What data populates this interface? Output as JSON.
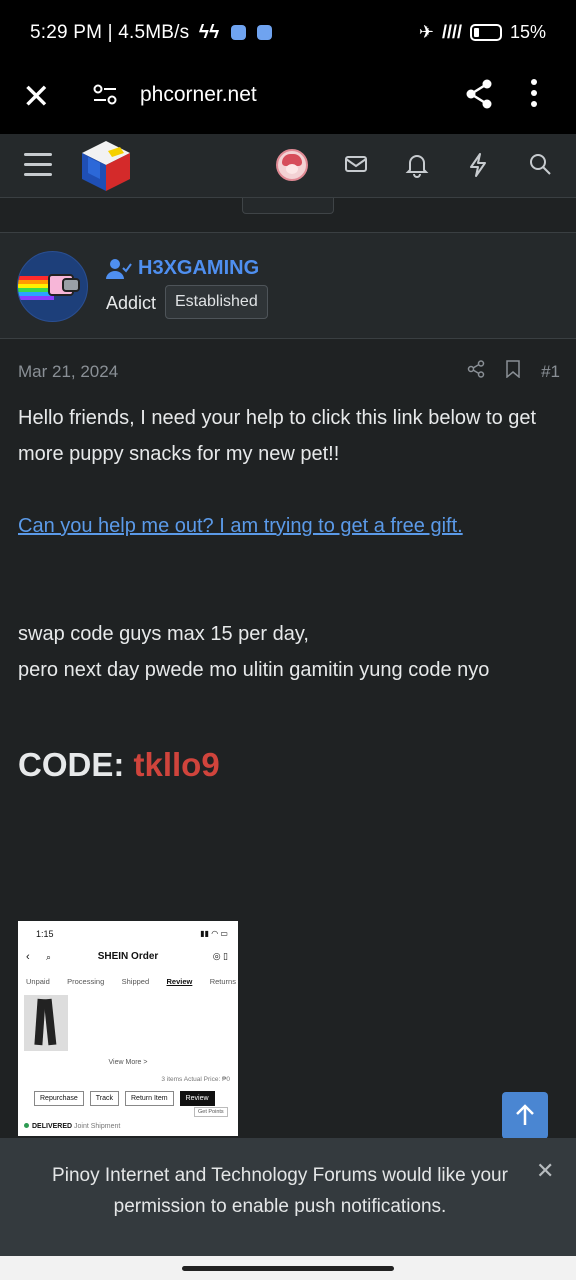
{
  "status_bar": {
    "time_speed": "5:29 PM | 4.5MB/s",
    "battery": "15%"
  },
  "browser": {
    "url": "phcorner.net",
    "close_icon": "close-icon",
    "share_icon": "share-icon",
    "more_icon": "more-vertical-icon"
  },
  "site_header": {
    "icons": [
      "menu-icon",
      "site-logo",
      "user-avatar",
      "mail-icon",
      "bell-icon",
      "bolt-icon",
      "search-icon"
    ]
  },
  "user": {
    "name": "H3XGAMING",
    "title": "Addict",
    "badge": "Established"
  },
  "post": {
    "date": "Mar 21, 2024",
    "number": "#1",
    "paragraph1": "Hello friends, I need your help to click this link below to get more puppy snacks for my new pet!!",
    "link_text": "Can you help me out? I am trying to get a free gift.",
    "line2a": "swap code guys max 15 per day,",
    "line2b": "pero next day pwede mo ulitin gamitin yung code nyo",
    "code_label": "CODE: ",
    "code_value": "tkllo9"
  },
  "screenshot": {
    "time": "1:15",
    "title": "SHEIN Order",
    "tabs": [
      "Unpaid",
      "Processing",
      "Shipped",
      "Review",
      "Returns"
    ],
    "view_more": "View More  >",
    "price": "3 items Actual Price: ₱0",
    "buttons": [
      "Repurchase",
      "Track",
      "Return Item",
      "Review"
    ],
    "get_points": "Get Points",
    "delivered": "DELIVERED",
    "joint": "Joint Shipment"
  },
  "push": {
    "message": "Pinoy Internet and Technology Forums would like your permission to enable push notifications."
  }
}
